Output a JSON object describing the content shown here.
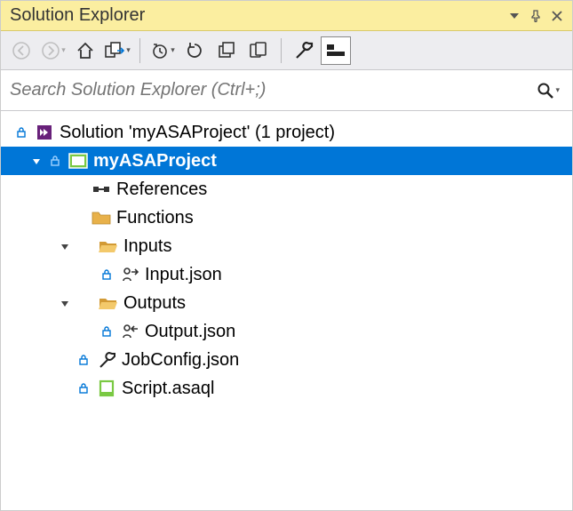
{
  "window": {
    "title": "Solution Explorer"
  },
  "search": {
    "placeholder": "Search Solution Explorer (Ctrl+;)"
  },
  "tree": {
    "solution": "Solution 'myASAProject' (1 project)",
    "project": "myASAProject",
    "references": "References",
    "functions": "Functions",
    "inputs": "Inputs",
    "input_json": "Input.json",
    "outputs": "Outputs",
    "output_json": "Output.json",
    "jobconfig": "JobConfig.json",
    "script": "Script.asaql"
  }
}
